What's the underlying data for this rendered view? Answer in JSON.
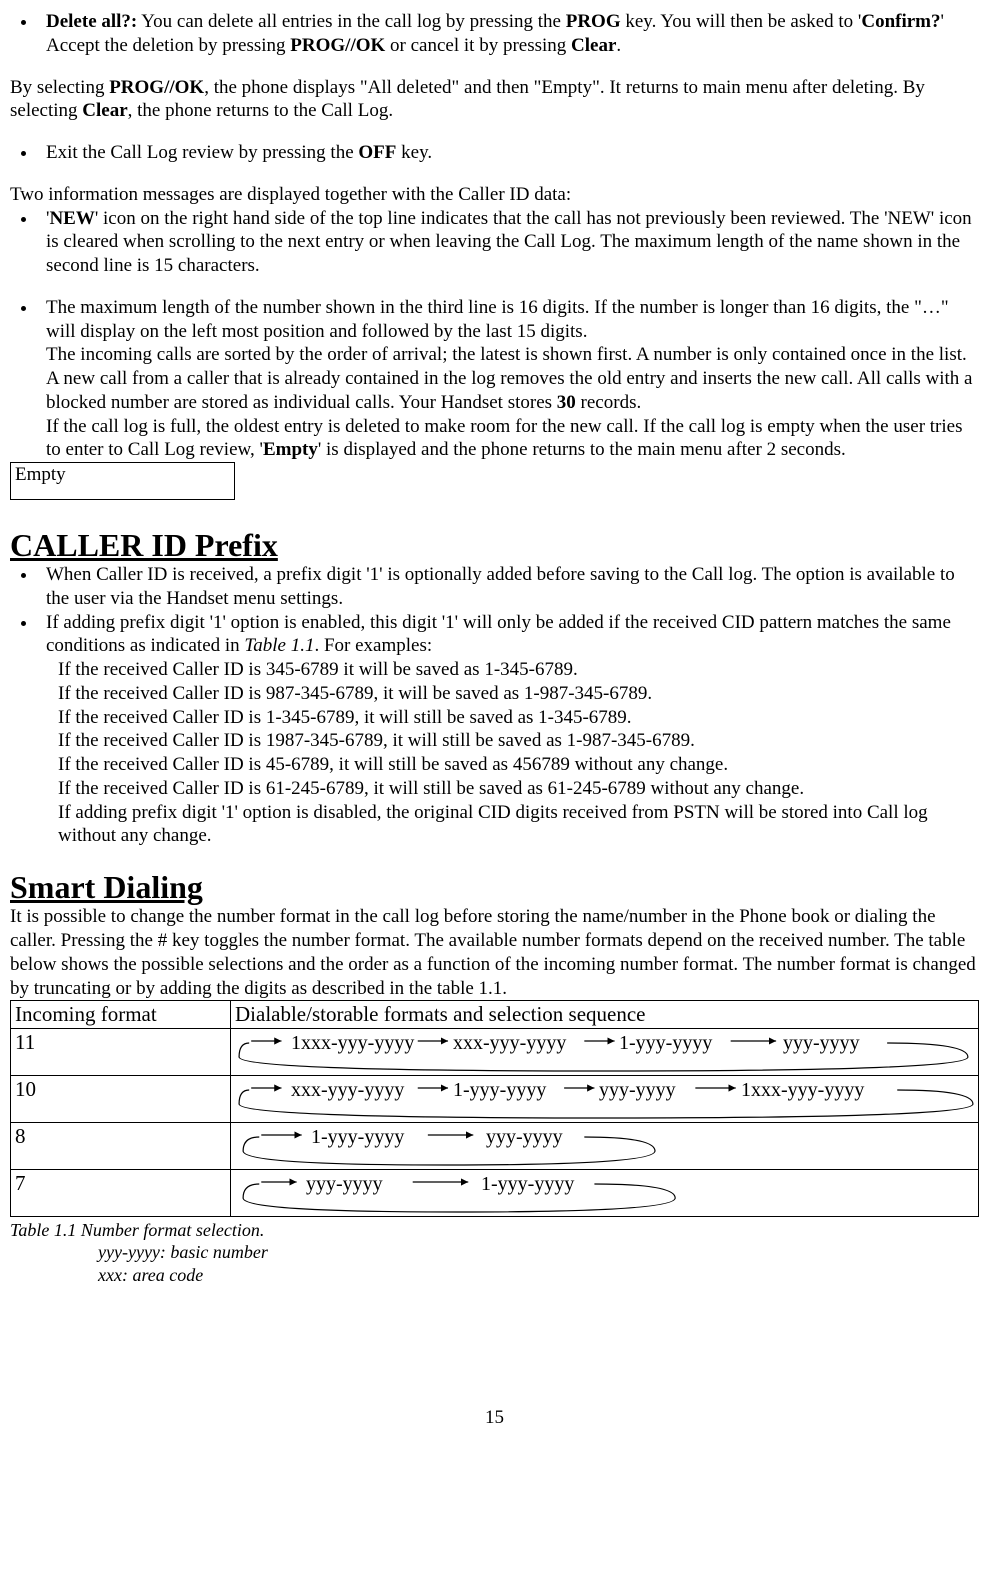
{
  "bullet_delete": {
    "prefix_bold": "Delete all?:",
    "text1": " You can delete all entries in the call log by pressing the ",
    "prog": "PROG",
    "text2": " key. You will then be asked to '",
    "confirm": "Confirm?",
    "text3": "'  Accept the deletion by pressing ",
    "progok": "PROG//OK",
    "text4": " or cancel it by pressing ",
    "clear": "Clear",
    "text5": "."
  },
  "para_select": {
    "t1": "By selecting ",
    "progok": "PROG//OK",
    "t2": ", the phone displays \"All deleted\" and then \"Empty\". It returns to main menu after deleting. By selecting ",
    "clear": "Clear",
    "t3": ", the phone returns to the Call Log."
  },
  "bullet_exit": {
    "t1": "Exit the Call Log review by pressing the ",
    "off": "OFF",
    "t2": " key."
  },
  "info_intro": "Two information messages are displayed together with the Caller ID data:",
  "bullet_new": {
    "t1": "'",
    "new": "NEW",
    "t2": "' icon on the right hand side of the top line indicates that the call has not previously been reviewed. The 'NEW' icon is cleared when scrolling to the next entry or when leaving the Call Log. The maximum length of the name shown in the second line is 15 characters."
  },
  "bullet_max": {
    "p1": "The maximum length of the number shown in the third line is 16 digits. If the number is longer than 16 digits, the \"…\" will display on the left most position and followed by the last 15 digits.",
    "p2a": "The incoming calls are sorted by the order of arrival; the latest is shown first. A number is only contained once in the list. A new call from a caller that is already contained in the log removes the old entry and inserts the new call. All calls with a blocked number are stored as individual calls.  Your Handset stores ",
    "thirty": "30",
    "p2b": " records.",
    "p3a": "If the call log is full, the oldest entry is deleted to make room for the new call. If the call log is empty when the user tries to enter to Call Log review, '",
    "empty": "Empty",
    "p3b": "' is displayed and the phone returns to the main menu after 2 seconds."
  },
  "empty_box": "Empty",
  "h_caller": "CALLER ID Prefix",
  "caller_b1": "When Caller ID is received, a prefix digit '1' is optionally added before saving to the Call log.   The option is available to the user via the Handset menu settings.",
  "caller_b2a": "If adding prefix digit '1' option is enabled, this digit '1' will only be added if the received CID pattern matches the same conditions as indicated in ",
  "caller_b2_tbl": "Table 1.1",
  "caller_b2b": ". For examples:",
  "caller_ex": [
    "If the received Caller ID is 345-6789 it will be saved as 1-345-6789.",
    "If the received Caller ID is 987-345-6789, it will be saved as 1-987-345-6789.",
    "If the received Caller ID is 1-345-6789, it will still be saved as 1-345-6789.",
    "If the received Caller ID is 1987-345-6789, it will still be saved as 1-987-345-6789.",
    "If the received Caller ID is 45-6789, it will still be saved as 456789 without any change.",
    "If the received Caller ID is 61-245-6789, it will still be saved as 61-245-6789 without any change.",
    "If adding prefix digit '1' option is disabled, the original CID digits received from PSTN will be stored into Call log without any change."
  ],
  "h_smart": "Smart Dialing",
  "smart_para": "It is possible to change the number format in the call log before storing the name/number in the Phone book or dialing the caller. Pressing the # key toggles the number format. The available number formats depend on the received number. The table below shows the possible selections and the order as a function of the incoming number format. The number format is changed by truncating or by adding the digits as described in the table 1.1.",
  "tbl": {
    "h1": "Incoming format",
    "h2": "Dialable/storable formats and selection sequence",
    "rows": [
      {
        "inc": "11",
        "seq": [
          "1xxx-yyy-yyyy",
          "xxx-yyy-yyyy",
          "1-yyy-yyyy",
          "yyy-yyyy"
        ]
      },
      {
        "inc": "10",
        "seq": [
          "xxx-yyy-yyyy",
          "1-yyy-yyyy",
          "yyy-yyyy",
          "1xxx-yyy-yyyy"
        ]
      },
      {
        "inc": "8",
        "seq": [
          "1-yyy-yyyy",
          "yyy-yyyy"
        ]
      },
      {
        "inc": "7",
        "seq": [
          "yyy-yyyy",
          "1-yyy-yyyy"
        ]
      }
    ]
  },
  "caption": {
    "l1": "Table 1.1    Number format selection.",
    "l2": "yyy-yyyy: basic number",
    "l3": "xxx: area code"
  },
  "page": "15",
  "chart_data": {
    "type": "table",
    "title": "Number format selection",
    "columns": [
      "Incoming format (digits)",
      "Dialable/storable formats cycle"
    ],
    "rows": [
      [
        "11",
        "1xxx-yyy-yyyy → xxx-yyy-yyyy → 1-yyy-yyyy → yyy-yyyy → (loops)"
      ],
      [
        "10",
        "xxx-yyy-yyyy → 1-yyy-yyyy → yyy-yyyy → 1xxx-yyy-yyyy → (loops)"
      ],
      [
        "8",
        "1-yyy-yyyy → yyy-yyyy → (loops)"
      ],
      [
        "7",
        "yyy-yyyy → 1-yyy-yyyy → (loops)"
      ]
    ],
    "notes": [
      "yyy-yyyy: basic number",
      "xxx: area code"
    ]
  }
}
